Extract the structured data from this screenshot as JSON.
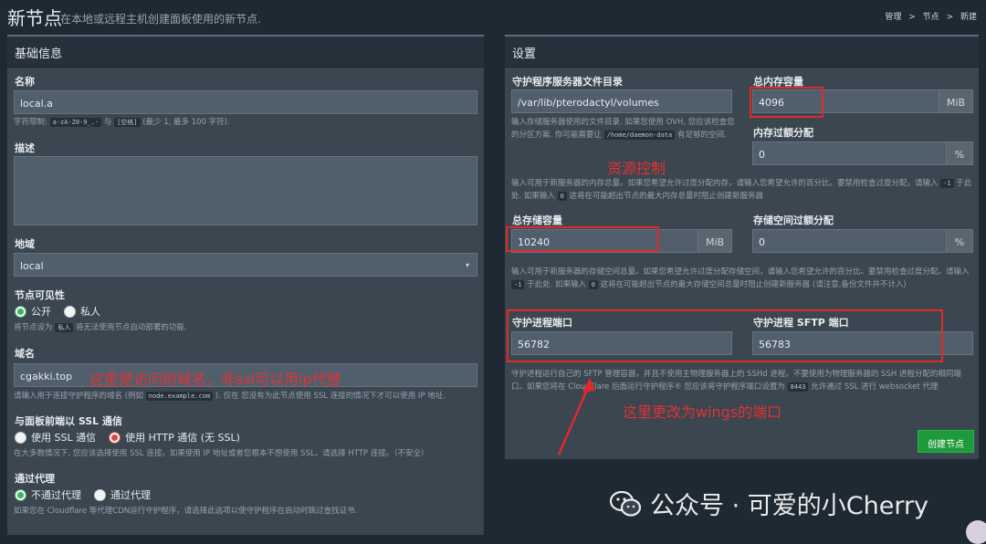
{
  "header": {
    "title": "新节点",
    "subtitle": "在本地或远程主机创建面板使用的新节点.",
    "breadcrumb": [
      "管理",
      "节点",
      "新建"
    ],
    "breadcrumb_sep": ">"
  },
  "basic": {
    "panel_title": "基础信息",
    "name_label": "名称",
    "name_value": "local.a",
    "name_help_prefix": "字符限制:",
    "name_help_code1": "a-zA-Z0-9_.-",
    "name_help_and": "与",
    "name_help_code2": "[空格]",
    "name_help_suffix": "(最少 1, 最多 100 字符).",
    "desc_label": "描述",
    "desc_value": "",
    "location_label": "地域",
    "location_value": "local",
    "visibility_label": "节点可见性",
    "visibility_options": [
      "公开",
      "私人"
    ],
    "visibility_help_prefix": "将节点设为",
    "visibility_help_code": "私人",
    "visibility_help_suffix": "将无法使用节点自动部署的功能.",
    "domain_label": "域名",
    "domain_value": "cgakki.top",
    "domain_help_prefix": "请输入用于连接守护程序的域名 (例如",
    "domain_help_code": "node.example.com",
    "domain_help_suffix": "). 仅在 您没有为此节点使用 SSL 连接的情况下才可以使用 IP 地址.",
    "ssl_label": "与面板前端以 SSL 通信",
    "ssl_options": [
      "使用 SSL 通信",
      "使用 HTTP 通信 (无 SSL)"
    ],
    "ssl_help": "在大多数情况下, 您应该选择使用 SSL 连接。如果使用 IP 地址或者您根本不想使用 SSL，请选择 HTTP 连接。（不安全）",
    "proxy_label": "通过代理",
    "proxy_options": [
      "不通过代理",
      "通过代理"
    ],
    "proxy_help": "如果您在 Cloudflare 等代理CDN运行守护程序，请选择此选项以使守护程序在启动时跳过查找证书."
  },
  "settings": {
    "panel_title": "设置",
    "dir_label": "守护程序服务器文件目录",
    "dir_value": "/var/lib/pterodactyl/volumes",
    "dir_help_prefix": "输入存储服务器使用的文件目录. 如果您使用 OVH, 您应该检查您的分区方案. 你可能需要让",
    "dir_help_code": "/home/daemon-data",
    "dir_help_suffix": "有足够的空间.",
    "memory_label": "总内存容量",
    "memory_value": "4096",
    "memory_unit": "MiB",
    "mem_over_label": "内存过额分配",
    "mem_over_value": "0",
    "mem_over_unit": "%",
    "memory_help_prefix": "输入可用于新服务器的内存总量。如果您希望允许过度分配内存，请输入您希望允许的百分比。要禁用检查过度分配，请输入",
    "memory_help_code1": "-1",
    "memory_help_mid": "于此处. 如果输入",
    "memory_help_code2": "0",
    "memory_help_suffix": "这将在可能超出节点的最大内存总量时阻止创建新服务器",
    "disk_label": "总存储容量",
    "disk_value": "10240",
    "disk_unit": "MiB",
    "disk_over_label": "存储空间过额分配",
    "disk_over_value": "0",
    "disk_over_unit": "%",
    "disk_help_prefix": "输入可用于新服务器的存储空间总量。如果您希望允许过度分配存储空间，请输入您希望允许的百分比。要禁用检查过度分配。请输入",
    "disk_help_code1": "-1",
    "disk_help_mid": "于此处. 如果输入",
    "disk_help_code2": "0",
    "disk_help_suffix": "这将在可能超出节点的最大存储空间总量时阻止创建新服务器 (请注意,备份文件并不计入)",
    "daemon_port_label": "守护进程端口",
    "daemon_port_value": "56782",
    "sftp_port_label": "守护进程 SFTP 端口",
    "sftp_port_value": "56783",
    "port_help_prefix": "守护进程运行自己的 SFTP 管理容器，并且不使用主物理服务器上的 SSHd 进程。不要使用为物理服务器的 SSH 进程分配的相同端口。如果您将在 CloudFlare 后面运行守护程序® 您应该将守护程序端口设置为",
    "port_help_code": "8443",
    "port_help_suffix": "允许通过 SSL 进行 websocket 代理",
    "create_button": "创建节点"
  },
  "annotations": {
    "resource": "资源控制",
    "domain": "这里是访问的域名，非ssl可以用ip代替",
    "ports": "这里更改为wings的端口",
    "color": "#e02a2a"
  },
  "watermark": "公众号 · 可爱的小Cherry"
}
